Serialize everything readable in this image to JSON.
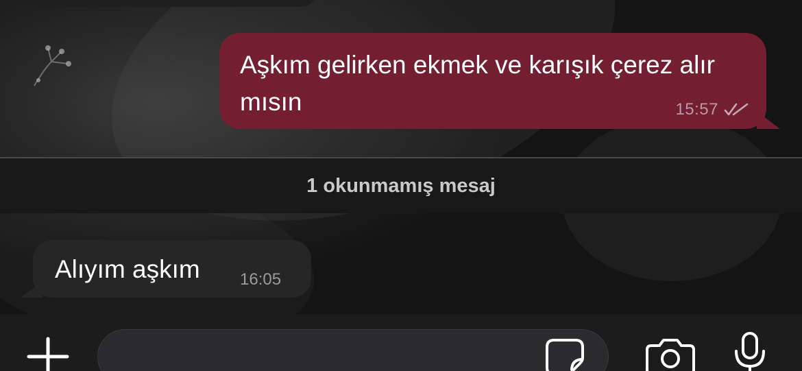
{
  "chat": {
    "outgoing": {
      "text": "Aşkım gelirken ekmek ve karışık çerez alır mısın",
      "time": "15:57",
      "status_icon": "double-check-icon"
    },
    "unread_divider": "1 okunmamış mesaj",
    "incoming": {
      "text": "Alıyım aşkım",
      "time": "16:05"
    }
  },
  "input_bar": {
    "message_value": "",
    "icons": [
      "plus-icon",
      "sticker-icon",
      "camera-icon",
      "microphone-icon"
    ]
  },
  "colors": {
    "outgoing_bubble": "#741e31",
    "incoming_bubble": "#262626",
    "input_bar_bg": "#1c1c1d"
  }
}
